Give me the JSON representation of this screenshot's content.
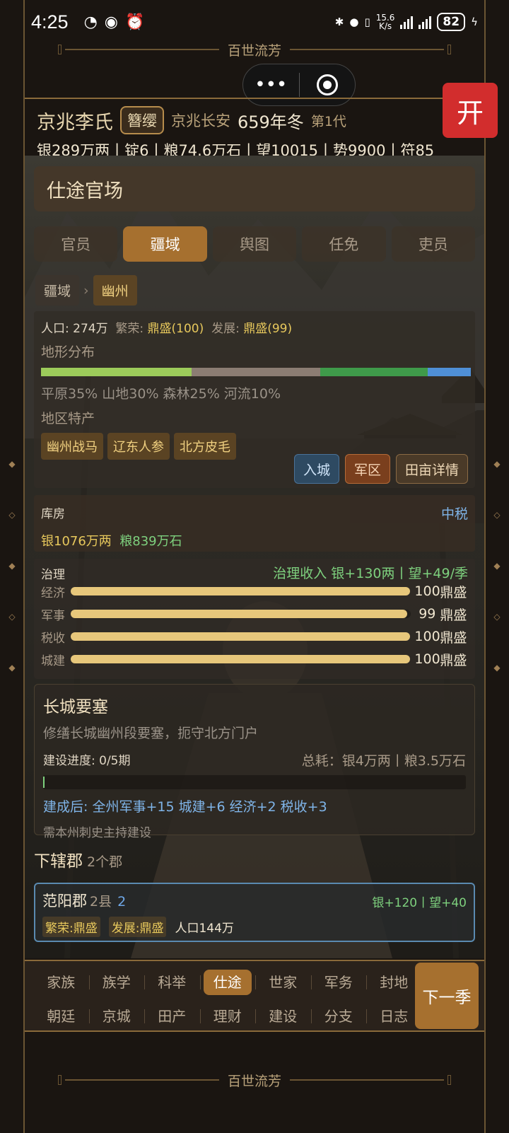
{
  "status_bar": {
    "time": "4:25",
    "speed_value": "15.6",
    "speed_unit": "K/s",
    "battery": "82"
  },
  "banner_title": "百世流芳",
  "close_label": "开",
  "clan": {
    "name": "京兆李氏",
    "rank_badge": "簪缨",
    "seat": "京兆长安",
    "year": "659年冬",
    "generation": "第1代",
    "resources": "银289万两丨锭6丨粮74.6万石丨望10015丨势9900丨符85"
  },
  "panel_title": "仕途官场",
  "tabs": [
    {
      "label": "官员",
      "active": false
    },
    {
      "label": "疆域",
      "active": true
    },
    {
      "label": "舆图",
      "active": false
    },
    {
      "label": "任免",
      "active": false
    },
    {
      "label": "吏员",
      "active": false
    }
  ],
  "breadcrumb": {
    "root": "疆域",
    "separator": "›",
    "current": "幽州"
  },
  "region": {
    "population_label": "人口:",
    "population": "274万",
    "prosperity_label": "繁荣:",
    "prosperity": "鼎盛(100)",
    "development_label": "发展:",
    "development": "鼎盛(99)",
    "terrain_heading": "地形分布",
    "terrain": [
      {
        "name": "平原",
        "percent": 35,
        "color": "#9ccb5a"
      },
      {
        "name": "山地",
        "percent": 30,
        "color": "#8c7d73"
      },
      {
        "name": "森林",
        "percent": 25,
        "color": "#3f9a4a"
      },
      {
        "name": "河流",
        "percent": 10,
        "color": "#4f8fd6"
      }
    ],
    "terrain_text": "平原35% 山地30% 森林25% 河流10%",
    "specialty_heading": "地区特产",
    "specialties": [
      "幽州战马",
      "辽东人参",
      "北方皮毛"
    ],
    "actions": {
      "enter_city": "入城",
      "military": "军区",
      "farmland": "田亩详情"
    }
  },
  "storage": {
    "title": "库房",
    "tax": "中税",
    "silver": "银1076万两",
    "grain": "粮839万石"
  },
  "governance": {
    "title": "治理",
    "income": "治理收入 银+130两丨望+49/季",
    "rows": [
      {
        "label": "经济",
        "value": "100",
        "level": "鼎盛",
        "fraction": 1.0
      },
      {
        "label": "军事",
        "value": "99",
        "level": "鼎盛",
        "fraction": 0.99
      },
      {
        "label": "税收",
        "value": "100",
        "level": "鼎盛",
        "fraction": 1.0
      },
      {
        "label": "城建",
        "value": "100",
        "level": "鼎盛",
        "fraction": 1.0
      }
    ]
  },
  "project": {
    "title": "长城要塞",
    "description": "修缮长城幽州段要塞，扼守北方门户",
    "progress_label": "建设进度: 0/5期",
    "progress_fraction": 0,
    "cost": "总耗：银4万两丨粮3.5万石",
    "effect": "建成后: 全州军事+15 城建+6 经济+2 税收+3",
    "requirement": "需本州刺史主持建设"
  },
  "subordinate": {
    "heading": "下辖郡",
    "count": "2个郡"
  },
  "counties": [
    {
      "name": "范阳郡",
      "counties": "2县",
      "extra": "2",
      "income": "银+120丨望+40",
      "prosperity": "繁荣:鼎盛",
      "development": "发展:鼎盛",
      "population": "人口144万"
    }
  ],
  "nav": {
    "row1": [
      {
        "label": "家族",
        "active": false
      },
      {
        "label": "族学",
        "active": false
      },
      {
        "label": "科举",
        "active": false
      },
      {
        "label": "仕途",
        "active": true
      },
      {
        "label": "世家",
        "active": false
      },
      {
        "label": "军务",
        "active": false
      },
      {
        "label": "封地",
        "active": false
      }
    ],
    "row2": [
      {
        "label": "朝廷",
        "active": false
      },
      {
        "label": "京城",
        "active": false
      },
      {
        "label": "田产",
        "active": false
      },
      {
        "label": "理财",
        "active": false
      },
      {
        "label": "建设",
        "active": false
      },
      {
        "label": "分支",
        "active": false
      },
      {
        "label": "日志",
        "active": false
      }
    ],
    "next_season": "下一季"
  }
}
